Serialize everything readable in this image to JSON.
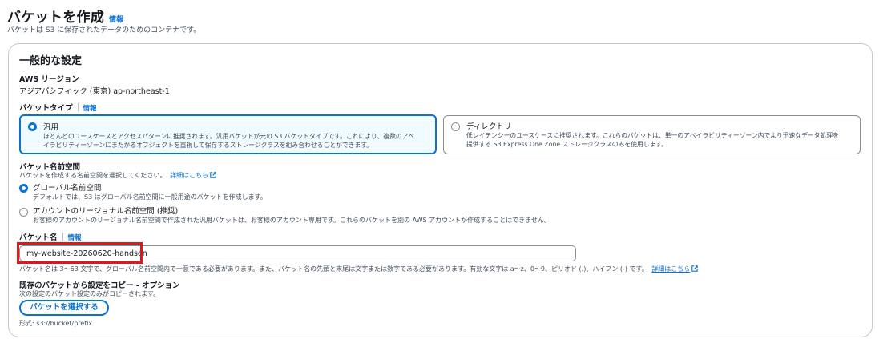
{
  "header": {
    "title": "バケットを作成",
    "info": "情報",
    "description": "バケットは S3 に保存されたデータのためのコンテナです。"
  },
  "general": {
    "title": "一般的な設定",
    "region_label": "AWS リージョン",
    "region_value": "アジアパシフィック (東京) ap-northeast-1",
    "bucket_type_label": "バケットタイプ",
    "bucket_type_info": "情報",
    "bucket_types": [
      {
        "title": "汎用",
        "description": "ほとんどのユースケースとアクセスパターンに推奨されます。汎用バケットが元の S3 バケットタイプです。これにより、複数のアベイラビリティーゾーンにまたがるオブジェクトを重視して保存するストレージクラスを組み合わせることができます。",
        "selected": true
      },
      {
        "title": "ディレクトリ",
        "description": "低レイテンシーのユースケースに推奨されます。これらのバケットは、単一のアベイラビリティーゾーン内でより迅速なデータ処理を提供する S3 Express One Zone ストレージクラスのみを使用します。",
        "selected": false
      }
    ],
    "namespace_label": "バケット名前空間",
    "namespace_desc": "バケットを作成する名前空間を選択してください。",
    "namespace_link": "詳細はこちら",
    "namespaces": [
      {
        "title": "グローバル名前空間",
        "description": "デフォルトでは、S3 はグローバル名前空間に一般用途のバケットを作成します。",
        "selected": true
      },
      {
        "title": "アカウントのリージョナル名前空間 (推奨)",
        "description": "お客様のアカウントのリージョナル名前空間で作成された汎用バケットは、お客様のアカウント専用です。これらのバケットを別の AWS アカウントが作成することはできません。",
        "selected": false
      }
    ],
    "bucket_name_label": "バケット名",
    "bucket_name_info": "情報",
    "bucket_name_value": "my-website-20260620-handson",
    "bucket_name_hint": "バケット名は 3〜63 文字で、グローバル名前空間内で一意である必要があります。また、バケット名の先頭と末尾は文字または数字である必要があります。有効な文字は a〜z、0〜9、ピリオド (.)、ハイフン (-) です。",
    "bucket_name_link": "詳細はこちら",
    "copy_label": "既存のバケットから設定をコピー - オプション",
    "copy_desc": "次の設定のバケット設定のみがコピーされます。",
    "copy_button": "バケットを選択する",
    "format_hint": "形式: s3://bucket/prefix"
  },
  "colors": {
    "accent": "#0972d3",
    "highlight": "#e0161a",
    "selected_bg": "#f0fbff"
  }
}
